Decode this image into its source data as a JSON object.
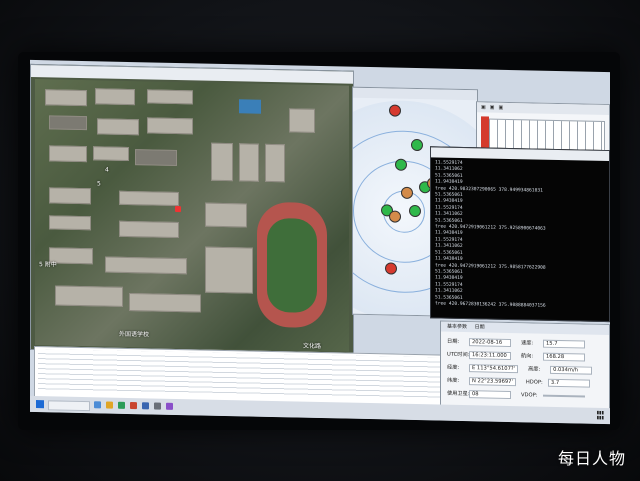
{
  "map_window": {
    "labels": [
      "4",
      "5",
      "5 附中",
      "外国语学校",
      "文化路"
    ]
  },
  "console": {
    "lines": [
      "11.5529174",
      "11.3411062",
      "51.5365061",
      "11.9430419",
      "tree 420.9832307290065 378.949934861031",
      "51.5365061",
      "11.9430419",
      "11.5529174",
      "11.3411062",
      "51.5365061",
      "tree 420.9472919061212 375.9258900674063",
      "11.9430419",
      "11.5529174",
      "11.3411062",
      "51.5365061",
      "11.9430419",
      "tree 420.9472919061212 375.9858177622908",
      "51.5365061",
      "11.9430419",
      "11.5529174",
      "11.3411062",
      "51.5365061",
      "tree 420.9672830136242 375.9088884037156"
    ]
  },
  "info_panel": {
    "tabs": [
      "基本参数",
      "日期"
    ],
    "rows": [
      {
        "label": "日期:",
        "value": "2022-08-16",
        "label2": "速度:",
        "value2": "15.7"
      },
      {
        "label": "UTC时间:",
        "value": "16:23:11.000",
        "label2": "航向:",
        "value2": "168.28"
      },
      {
        "label": "经度:",
        "value": "E 113°54.6107?'",
        "label2": "高度:",
        "value2": "0.034m/h"
      },
      {
        "label": "纬度:",
        "value": "N 22°23.59697'",
        "label2": "HDOP:",
        "value2": "3.7"
      },
      {
        "label": "使用卫星:",
        "value": "08",
        "label2": "VDOP:",
        "value2": ""
      }
    ]
  },
  "watermark": "每日人物",
  "colors": {
    "sat_green": "#2fb84a",
    "sat_red": "#d63a2f",
    "console_bg": "#050505",
    "track": "#b5554e"
  }
}
